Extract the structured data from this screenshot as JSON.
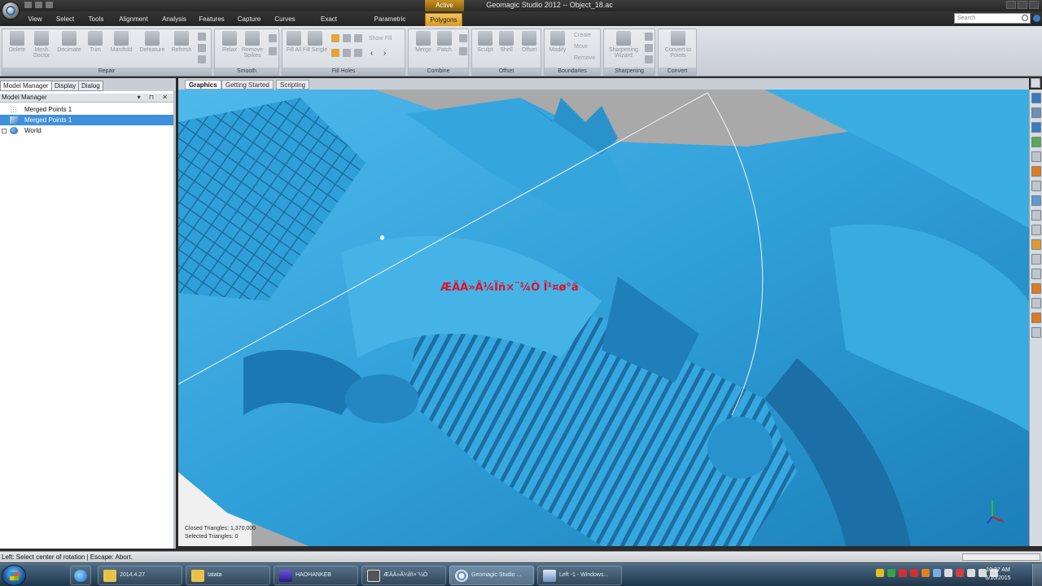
{
  "titlebar": {
    "context_label": "Active",
    "title": "Geomagic Studio 2012 -- Object_18.ac"
  },
  "ribbon_tabs": [
    {
      "label": "View"
    },
    {
      "label": "Select"
    },
    {
      "label": "Tools"
    },
    {
      "label": "Alignment"
    },
    {
      "label": "Analysis"
    },
    {
      "label": "Features"
    },
    {
      "label": "Capture"
    },
    {
      "label": "Curves"
    },
    {
      "label": "Exact Surfaces"
    },
    {
      "label": "Parametric Surfaces"
    },
    {
      "label": "Polygons"
    }
  ],
  "search": {
    "placeholder": "Search"
  },
  "ribbon": {
    "repair": {
      "label": "Repair",
      "buttons": [
        "Delete",
        "Mesh Doctor",
        "Decimate",
        "Trim",
        "Manifold",
        "Defeature",
        "Refresh"
      ]
    },
    "smooth": {
      "label": "Smooth",
      "buttons": [
        "Relax",
        "Remove Spikes"
      ]
    },
    "fill_holes": {
      "label": "Fill Holes",
      "buttons": [
        "Fill All",
        "Fill Single"
      ],
      "show_fill": "Show Fill"
    },
    "combine": {
      "label": "Combine",
      "buttons": [
        "Merge",
        "Patch"
      ]
    },
    "offset": {
      "label": "Offset",
      "buttons": [
        "Sculpt",
        "Shell",
        "Offset"
      ]
    },
    "boundaries": {
      "label": "Boundaries",
      "buttons": [
        "Modify"
      ],
      "small": [
        "Create",
        "Move",
        "Remove"
      ]
    },
    "sharpening": {
      "label": "Sharpening",
      "buttons": [
        "Sharpening Wizard"
      ]
    },
    "convert": {
      "label": "Convert",
      "buttons": [
        "Convert to Points"
      ]
    }
  },
  "left_panel": {
    "tabs": [
      "Model Manager",
      "Display",
      "Dialog"
    ],
    "header": "Model Manager",
    "tree": [
      {
        "label": "Merged Points 1",
        "selected": false
      },
      {
        "label": "Merged Points 1",
        "selected": true
      },
      {
        "label": "World",
        "selected": false
      }
    ]
  },
  "doc_tabs": [
    "Graphics",
    "Getting Started",
    "Scripting"
  ],
  "viewport": {
    "overlay_text": "ÆÄÀ»Â¼Ïñ×¨¼Ò Î¹¤ø°ä",
    "stats_line1": "Closed Triangles: 1,370,000",
    "stats_line2": "Selected Triangles: 0",
    "mesh_color": "#2f9fd8",
    "background_color": "#a9a9a9"
  },
  "statusbar": {
    "text": "Left: Select center of rotation | Escape: Abort."
  },
  "taskbar": {
    "buttons": [
      {
        "label": "2014.4.27",
        "icon": "folder-icon"
      },
      {
        "label": "tatata",
        "icon": "folder-icon"
      },
      {
        "label": "HAOHANKEB",
        "icon": "app-icon"
      },
      {
        "label": "ÆÄÀ»Â¼Ïñ×¨¼Ò",
        "icon": "recorder-icon"
      },
      {
        "label": "Geomagic Studio ...",
        "icon": "geomagic-icon"
      },
      {
        "label": "Left -1 - Windows...",
        "icon": "window-icon"
      }
    ],
    "time": "10:27 AM",
    "date": "6/10/2015"
  }
}
